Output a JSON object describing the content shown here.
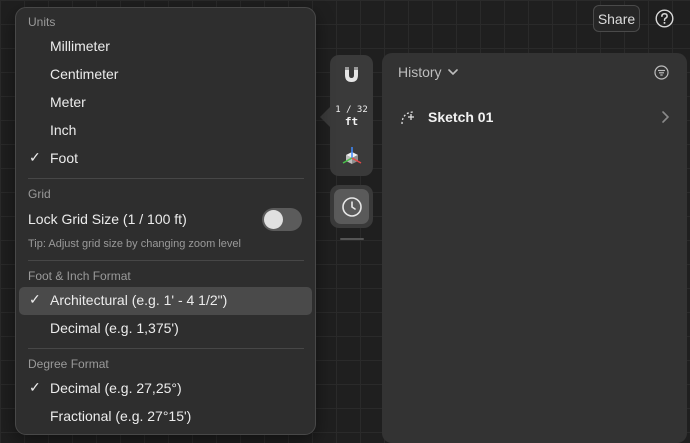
{
  "topbar": {
    "share_label": "Share",
    "help_icon": "question-icon"
  },
  "toolbar": {
    "magnet_icon": "magnet-icon",
    "scale_fraction": "1 / 32",
    "scale_unit": "ft",
    "axes_icon": "axes-cube-icon",
    "clock_icon": "clock-icon"
  },
  "history": {
    "title": "History",
    "items": [
      {
        "label": "Sketch 01"
      }
    ]
  },
  "menu": {
    "units": {
      "header": "Units",
      "items": [
        "Millimeter",
        "Centimeter",
        "Meter",
        "Inch",
        "Foot"
      ],
      "selected": "Foot"
    },
    "grid": {
      "header": "Grid",
      "lock_label": "Lock Grid Size (1 / 100 ft)",
      "lock_on": false,
      "tip": "Tip: Adjust grid size by changing zoom level"
    },
    "foot_inch": {
      "header": "Foot & Inch Format",
      "items": [
        "Architectural (e.g. 1' - 4 1/2\")",
        "Decimal (e.g. 1,375')"
      ],
      "selected": "Architectural (e.g. 1' - 4 1/2\")"
    },
    "degree": {
      "header": "Degree Format",
      "items": [
        "Decimal (e.g. 27,25°)",
        "Fractional (e.g. 27°15')"
      ],
      "selected": "Decimal (e.g. 27,25°)"
    },
    "check_glyph": "✓"
  },
  "colors": {
    "background": "#1f1f1f",
    "panel": "#333333",
    "menu": "#2e2e2e",
    "highlight": "#4a4a4a",
    "text": "#ececec",
    "muted": "#9a9a9a"
  }
}
